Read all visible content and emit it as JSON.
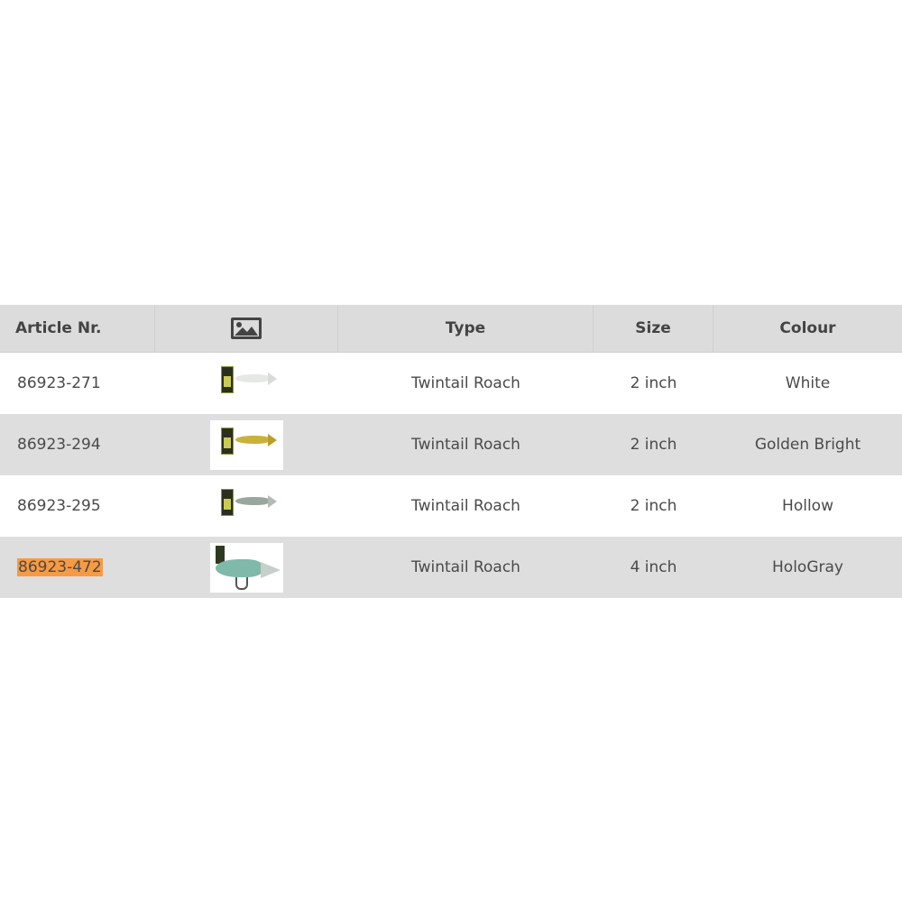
{
  "table": {
    "headers": {
      "article": "Article Nr.",
      "image_icon": "image-icon",
      "type": "Type",
      "size": "Size",
      "colour": "Colour"
    },
    "rows": [
      {
        "article": "86923-271",
        "type": "Twintail Roach",
        "size": "2 inch",
        "colour": "White",
        "highlighted": false
      },
      {
        "article": "86923-294",
        "type": "Twintail Roach",
        "size": "2 inch",
        "colour": "Golden Bright",
        "highlighted": false
      },
      {
        "article": "86923-295",
        "type": "Twintail Roach",
        "size": "2 inch",
        "colour": "Hollow",
        "highlighted": false
      },
      {
        "article": "86923-472",
        "type": "Twintail Roach",
        "size": "4 inch",
        "colour": "HoloGray",
        "highlighted": true
      }
    ]
  },
  "colors": {
    "header_bg": "#dcdcdc",
    "alt_row_bg": "#dedede",
    "highlight": "#f79a43",
    "text": "#444444"
  }
}
